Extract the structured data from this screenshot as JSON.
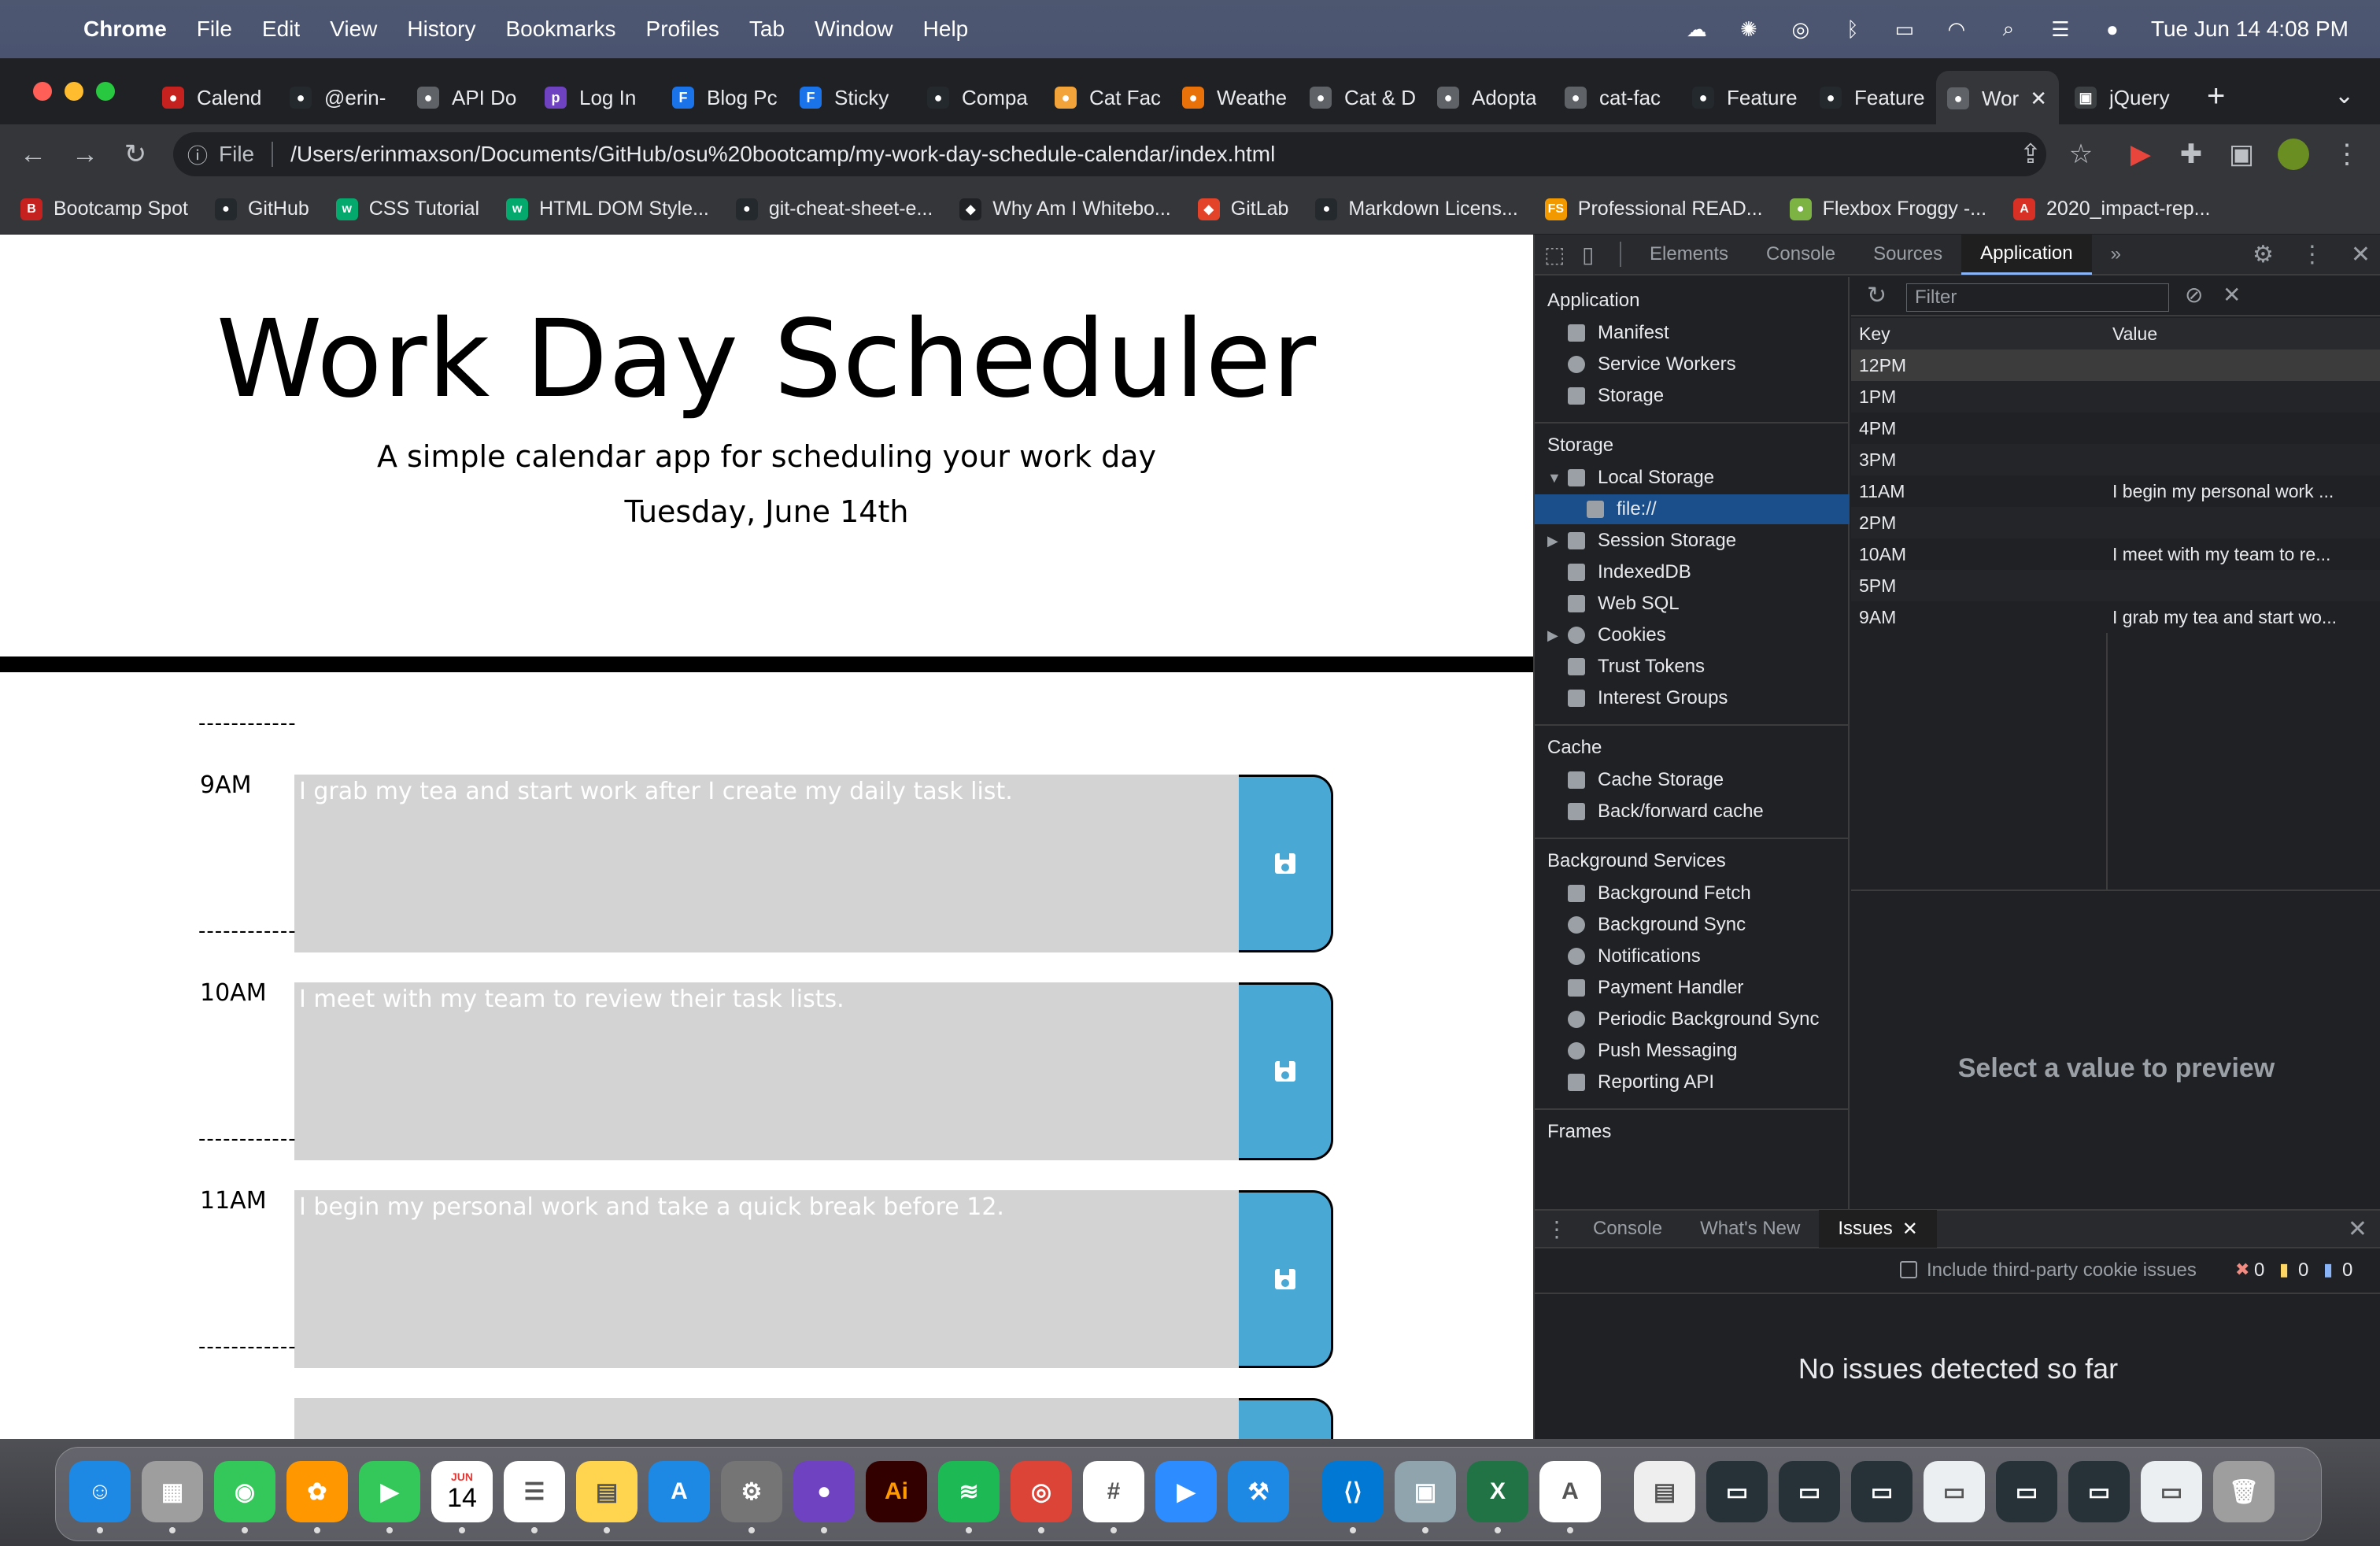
{
  "menubar": {
    "app_name": "Chrome",
    "items": [
      "File",
      "Edit",
      "View",
      "History",
      "Bookmarks",
      "Profiles",
      "Tab",
      "Window",
      "Help"
    ],
    "datetime": "Tue Jun 14  4:08 PM"
  },
  "tabs": [
    {
      "label": "Calend",
      "color": "#c5221f",
      "glyph": "●"
    },
    {
      "label": "@erin-",
      "color": "#24292e",
      "glyph": "●"
    },
    {
      "label": "API Do",
      "color": "#5f6368",
      "glyph": "●"
    },
    {
      "label": "Log In",
      "color": "#6f42c1",
      "glyph": "p"
    },
    {
      "label": "Blog Pc",
      "color": "#1a73e8",
      "glyph": "F"
    },
    {
      "label": "Sticky",
      "color": "#1a73e8",
      "glyph": "F"
    },
    {
      "label": "Compa",
      "color": "#24292e",
      "glyph": "●"
    },
    {
      "label": "Cat Fac",
      "color": "#f2a33a",
      "glyph": "●"
    },
    {
      "label": "Weathe",
      "color": "#e8710a",
      "glyph": "●"
    },
    {
      "label": "Cat & D",
      "color": "#5f6368",
      "glyph": "●"
    },
    {
      "label": "Adopta",
      "color": "#5f6368",
      "glyph": "●"
    },
    {
      "label": "cat-fac",
      "color": "#5f6368",
      "glyph": "●"
    },
    {
      "label": "Feature",
      "color": "#24292e",
      "glyph": "●"
    },
    {
      "label": "Feature",
      "color": "#24292e",
      "glyph": "●"
    },
    {
      "label": "Wor",
      "color": "#5f6368",
      "glyph": "●",
      "active": true
    },
    {
      "label": "jQuery",
      "color": "#3c4043",
      "glyph": "▣"
    }
  ],
  "toolbar": {
    "url_scheme": "File",
    "url": "/Users/erinmaxson/Documents/GitHub/osu%20bootcamp/my-work-day-schedule-calendar/index.html"
  },
  "bookmarks": [
    {
      "label": "Bootcamp Spot",
      "color": "#c5221f",
      "glyph": "B"
    },
    {
      "label": "GitHub",
      "color": "#24292e",
      "glyph": "●"
    },
    {
      "label": "CSS Tutorial",
      "color": "#04aa6d",
      "glyph": "w"
    },
    {
      "label": "HTML DOM Style...",
      "color": "#04aa6d",
      "glyph": "w"
    },
    {
      "label": "git-cheat-sheet-e...",
      "color": "#24292e",
      "glyph": "●"
    },
    {
      "label": "Why Am I Whitebo...",
      "color": "#202124",
      "glyph": "◆"
    },
    {
      "label": "GitLab",
      "color": "#e24329",
      "glyph": "◆"
    },
    {
      "label": "Markdown Licens...",
      "color": "#24292e",
      "glyph": "●"
    },
    {
      "label": "Professional READ...",
      "color": "#f29900",
      "glyph": "FS"
    },
    {
      "label": "Flexbox Froggy -...",
      "color": "#7cb342",
      "glyph": "●"
    },
    {
      "label": "2020_impact-rep...",
      "color": "#d93025",
      "glyph": "A"
    }
  ],
  "page": {
    "title": "Work Day Scheduler",
    "subtitle": "A simple calendar app for scheduling your work day",
    "date": "Tuesday, June 14th",
    "dashes": "------------",
    "time_blocks": [
      {
        "hour": "9AM",
        "text": "I grab my tea and start work after I create my daily task list."
      },
      {
        "hour": "10AM",
        "text": "I meet with my team to review their task lists."
      },
      {
        "hour": "11AM",
        "text": "I begin my personal work and take a quick break before 12."
      },
      {
        "hour": "",
        "text": ""
      }
    ]
  },
  "devtools": {
    "tabs": [
      "Elements",
      "Console",
      "Sources",
      "Application"
    ],
    "active_tab": "Application",
    "more_tabs": "»",
    "sidebar": {
      "application_head": "Application",
      "application_items": [
        "Manifest",
        "Service Workers",
        "Storage"
      ],
      "storage_head": "Storage",
      "storage_items": [
        "Local Storage",
        "file://",
        "Session Storage",
        "IndexedDB",
        "Web SQL",
        "Cookies",
        "Trust Tokens",
        "Interest Groups"
      ],
      "cache_head": "Cache",
      "cache_items": [
        "Cache Storage",
        "Back/forward cache"
      ],
      "bg_head": "Background Services",
      "bg_items": [
        "Background Fetch",
        "Background Sync",
        "Notifications",
        "Payment Handler",
        "Periodic Background Sync",
        "Push Messaging",
        "Reporting API"
      ],
      "frames_head": "Frames"
    },
    "filter_placeholder": "Filter",
    "table": {
      "key_header": "Key",
      "value_header": "Value",
      "rows": [
        {
          "key": "12PM",
          "value": ""
        },
        {
          "key": "1PM",
          "value": ""
        },
        {
          "key": "4PM",
          "value": ""
        },
        {
          "key": "3PM",
          "value": ""
        },
        {
          "key": "11AM",
          "value": "I begin my personal work ..."
        },
        {
          "key": "2PM",
          "value": ""
        },
        {
          "key": "10AM",
          "value": "I meet with my team to re..."
        },
        {
          "key": "5PM",
          "value": ""
        },
        {
          "key": "9AM",
          "value": "I grab my tea and start wo..."
        }
      ]
    },
    "preview_text": "Select a value to preview",
    "drawer_tabs": [
      "Console",
      "What's New",
      "Issues"
    ],
    "issues": {
      "third_party_label": "Include third-party cookie issues",
      "errors": "0",
      "warnings": "0",
      "infos": "0",
      "empty_text": "No issues detected so far"
    }
  },
  "dock": {
    "calendar_month": "JUN",
    "calendar_day": "14",
    "illustrator": "Ai"
  }
}
